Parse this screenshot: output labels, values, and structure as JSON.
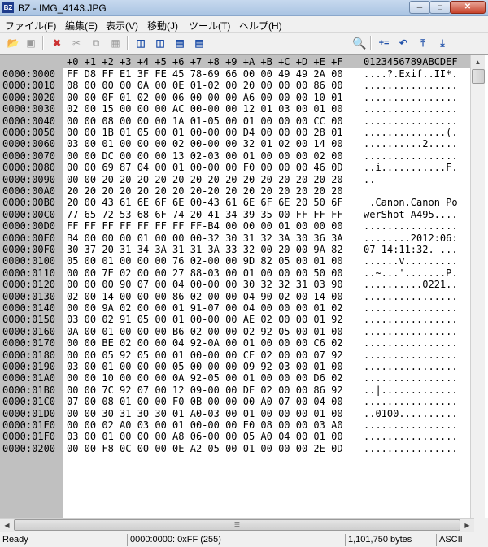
{
  "window": {
    "title": "BZ - IMG_4143.JPG",
    "icon_text": "BZ"
  },
  "menu": [
    {
      "label": "ファイル(F)"
    },
    {
      "label": "編集(E)"
    },
    {
      "label": "表示(V)"
    },
    {
      "label": "移動(J)"
    },
    {
      "label": "ツール(T)"
    },
    {
      "label": "ヘルプ(H)"
    }
  ],
  "toolbar": {
    "search_value": ""
  },
  "editor": {
    "header_hex": "+0 +1 +2 +3 +4 +5 +6 +7 +8 +9 +A +B +C +D +E +F",
    "header_ascii": "0123456789ABCDEF",
    "rows": [
      {
        "addr": "0000:0000",
        "hex": "FF D8 FF E1 3F FE 45 78-69 66 00 00 49 49 2A 00",
        "ascii": "....?.Exif..II*."
      },
      {
        "addr": "0000:0010",
        "hex": "08 00 00 00 0A 00 0E 01-02 00 20 00 00 00 86 00",
        "ascii": "................"
      },
      {
        "addr": "0000:0020",
        "hex": "00 00 0F 01 02 00 06 00-00 00 A6 00 00 00 10 01",
        "ascii": "................"
      },
      {
        "addr": "0000:0030",
        "hex": "02 00 15 00 00 00 AC 00-00 00 12 01 03 00 01 00",
        "ascii": "................"
      },
      {
        "addr": "0000:0040",
        "hex": "00 00 08 00 00 00 1A 01-05 00 01 00 00 00 CC 00",
        "ascii": "................"
      },
      {
        "addr": "0000:0050",
        "hex": "00 00 1B 01 05 00 01 00-00 00 D4 00 00 00 28 01",
        "ascii": "..............(."
      },
      {
        "addr": "0000:0060",
        "hex": "03 00 01 00 00 00 02 00-00 00 32 01 02 00 14 00",
        "ascii": "..........2....."
      },
      {
        "addr": "0000:0070",
        "hex": "00 00 DC 00 00 00 13 02-03 00 01 00 00 00 02 00",
        "ascii": "................"
      },
      {
        "addr": "0000:0080",
        "hex": "00 00 69 87 04 00 01 00-00 00 F0 00 00 00 46 0D",
        "ascii": "..i...........F."
      },
      {
        "addr": "0000:0090",
        "hex": "00 00 20 20 20 20 20 20-20 20 20 20 20 20 20 20",
        "ascii": "..              "
      },
      {
        "addr": "0000:00A0",
        "hex": "20 20 20 20 20 20 20 20-20 20 20 20 20 20 20 20",
        "ascii": "                "
      },
      {
        "addr": "0000:00B0",
        "hex": "20 00 43 61 6E 6F 6E 00-43 61 6E 6F 6E 20 50 6F",
        "ascii": " .Canon.Canon Po"
      },
      {
        "addr": "0000:00C0",
        "hex": "77 65 72 53 68 6F 74 20-41 34 39 35 00 FF FF FF",
        "ascii": "werShot A495...."
      },
      {
        "addr": "0000:00D0",
        "hex": "FF FF FF FF FF FF FF FF-B4 00 00 00 01 00 00 00",
        "ascii": "................"
      },
      {
        "addr": "0000:00E0",
        "hex": "B4 00 00 00 01 00 00 00-32 30 31 32 3A 30 36 3A",
        "ascii": "........2012:06:"
      },
      {
        "addr": "0000:00F0",
        "hex": "30 37 20 31 34 3A 31 31-3A 33 32 00 20 00 9A 82",
        "ascii": "07 14:11:32. ..."
      },
      {
        "addr": "0000:0100",
        "hex": "05 00 01 00 00 00 76 02-00 00 9D 82 05 00 01 00",
        "ascii": "......v........."
      },
      {
        "addr": "0000:0110",
        "hex": "00 00 7E 02 00 00 27 88-03 00 01 00 00 00 50 00",
        "ascii": "..~...'.......P."
      },
      {
        "addr": "0000:0120",
        "hex": "00 00 00 90 07 00 04 00-00 00 30 32 32 31 03 90",
        "ascii": "..........0221.."
      },
      {
        "addr": "0000:0130",
        "hex": "02 00 14 00 00 00 86 02-00 00 04 90 02 00 14 00",
        "ascii": "................"
      },
      {
        "addr": "0000:0140",
        "hex": "00 00 9A 02 00 00 01 91-07 00 04 00 00 00 01 02",
        "ascii": "................"
      },
      {
        "addr": "0000:0150",
        "hex": "03 00 02 91 05 00 01 00-00 00 AE 02 00 00 01 92",
        "ascii": "................"
      },
      {
        "addr": "0000:0160",
        "hex": "0A 00 01 00 00 00 B6 02-00 00 02 92 05 00 01 00",
        "ascii": "................"
      },
      {
        "addr": "0000:0170",
        "hex": "00 00 BE 02 00 00 04 92-0A 00 01 00 00 00 C6 02",
        "ascii": "................"
      },
      {
        "addr": "0000:0180",
        "hex": "00 00 05 92 05 00 01 00-00 00 CE 02 00 00 07 92",
        "ascii": "................"
      },
      {
        "addr": "0000:0190",
        "hex": "03 00 01 00 00 00 05 00-00 00 09 92 03 00 01 00",
        "ascii": "................"
      },
      {
        "addr": "0000:01A0",
        "hex": "00 00 10 00 00 00 0A 92-05 00 01 00 00 00 D6 02",
        "ascii": "................"
      },
      {
        "addr": "0000:01B0",
        "hex": "00 00 7C 92 07 00 12 09-00 00 DE 02 00 00 86 92",
        "ascii": "..|............."
      },
      {
        "addr": "0000:01C0",
        "hex": "07 00 08 01 00 00 F0 0B-00 00 00 A0 07 00 04 00",
        "ascii": "................"
      },
      {
        "addr": "0000:01D0",
        "hex": "00 00 30 31 30 30 01 A0-03 00 01 00 00 00 01 00",
        "ascii": "..0100.........."
      },
      {
        "addr": "0000:01E0",
        "hex": "00 00 02 A0 03 00 01 00-00 00 E0 08 00 00 03 A0",
        "ascii": "................"
      },
      {
        "addr": "0000:01F0",
        "hex": "03 00 01 00 00 00 A8 06-00 00 05 A0 04 00 01 00",
        "ascii": "................"
      },
      {
        "addr": "0000:0200",
        "hex": "00 00 F8 0C 00 00 0E A2-05 00 01 00 00 00 2E 0D",
        "ascii": "................"
      }
    ]
  },
  "status": {
    "ready": "Ready",
    "position": "0000:0000: 0xFF (255)",
    "size": "1,101,750 bytes",
    "encoding": "ASCII"
  }
}
